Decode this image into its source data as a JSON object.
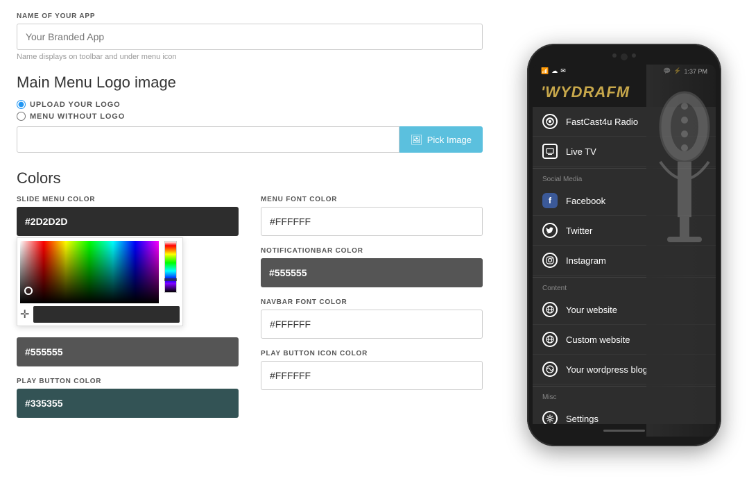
{
  "left": {
    "app_name_label": "NAME OF YOUR APP",
    "app_name_placeholder": "Your Branded App",
    "app_name_hint": "Name displays on toolbar and under menu icon",
    "logo_section_title": "Main Menu Logo image",
    "radio_upload": "UPLOAD YOUR LOGO",
    "radio_without": "MENU WITHOUT LOGO",
    "pick_image_btn": "Pick Image",
    "colors_title": "Colors",
    "slide_menu_color_label": "SLIDE MENU COLOR",
    "slide_menu_color_value": "#2D2D2D",
    "slide_menu_color_hex": "#2D2D2D",
    "menu_font_color_label": "MENU FONT COLOR",
    "menu_font_color_value": "#FFFFFF",
    "notif_color_label": "NOTIFICATIONBAR COLOR",
    "notif_color_value": "#555555",
    "notif_color_hex": "#555555",
    "navbar_font_color_label": "NAVBAR FONT COLOR",
    "navbar_font_color_value": "#FFFFFF",
    "play_btn_color_label": "PLAY BUTTON COLOR",
    "play_btn_color_value": "#335355",
    "play_btn_icon_color_label": "PLAY BUTTON ICON COLOR",
    "play_btn_icon_color_value": "#FFFFFF"
  },
  "phone": {
    "status_bar": {
      "time": "1:37 PM",
      "icons": "wifi cloud mail chat battery"
    },
    "logo_text": "'WYDRAFM",
    "menu_items_main": [
      {
        "label": "FastCast4u Radio",
        "icon": "radio"
      },
      {
        "label": "Live TV",
        "icon": "tv"
      }
    ],
    "section_social": "Social Media",
    "menu_items_social": [
      {
        "label": "Facebook",
        "icon": "facebook"
      },
      {
        "label": "Twitter",
        "icon": "twitter"
      },
      {
        "label": "Instagram",
        "icon": "instagram"
      }
    ],
    "section_content": "Content",
    "menu_items_content": [
      {
        "label": "Your website",
        "icon": "globe"
      },
      {
        "label": "Custom website",
        "icon": "globe"
      },
      {
        "label": "Your wordpress blog",
        "icon": "wordpress"
      }
    ],
    "section_misc": "Misc",
    "menu_items_misc": [
      {
        "label": "Settings",
        "icon": "settings"
      }
    ]
  }
}
